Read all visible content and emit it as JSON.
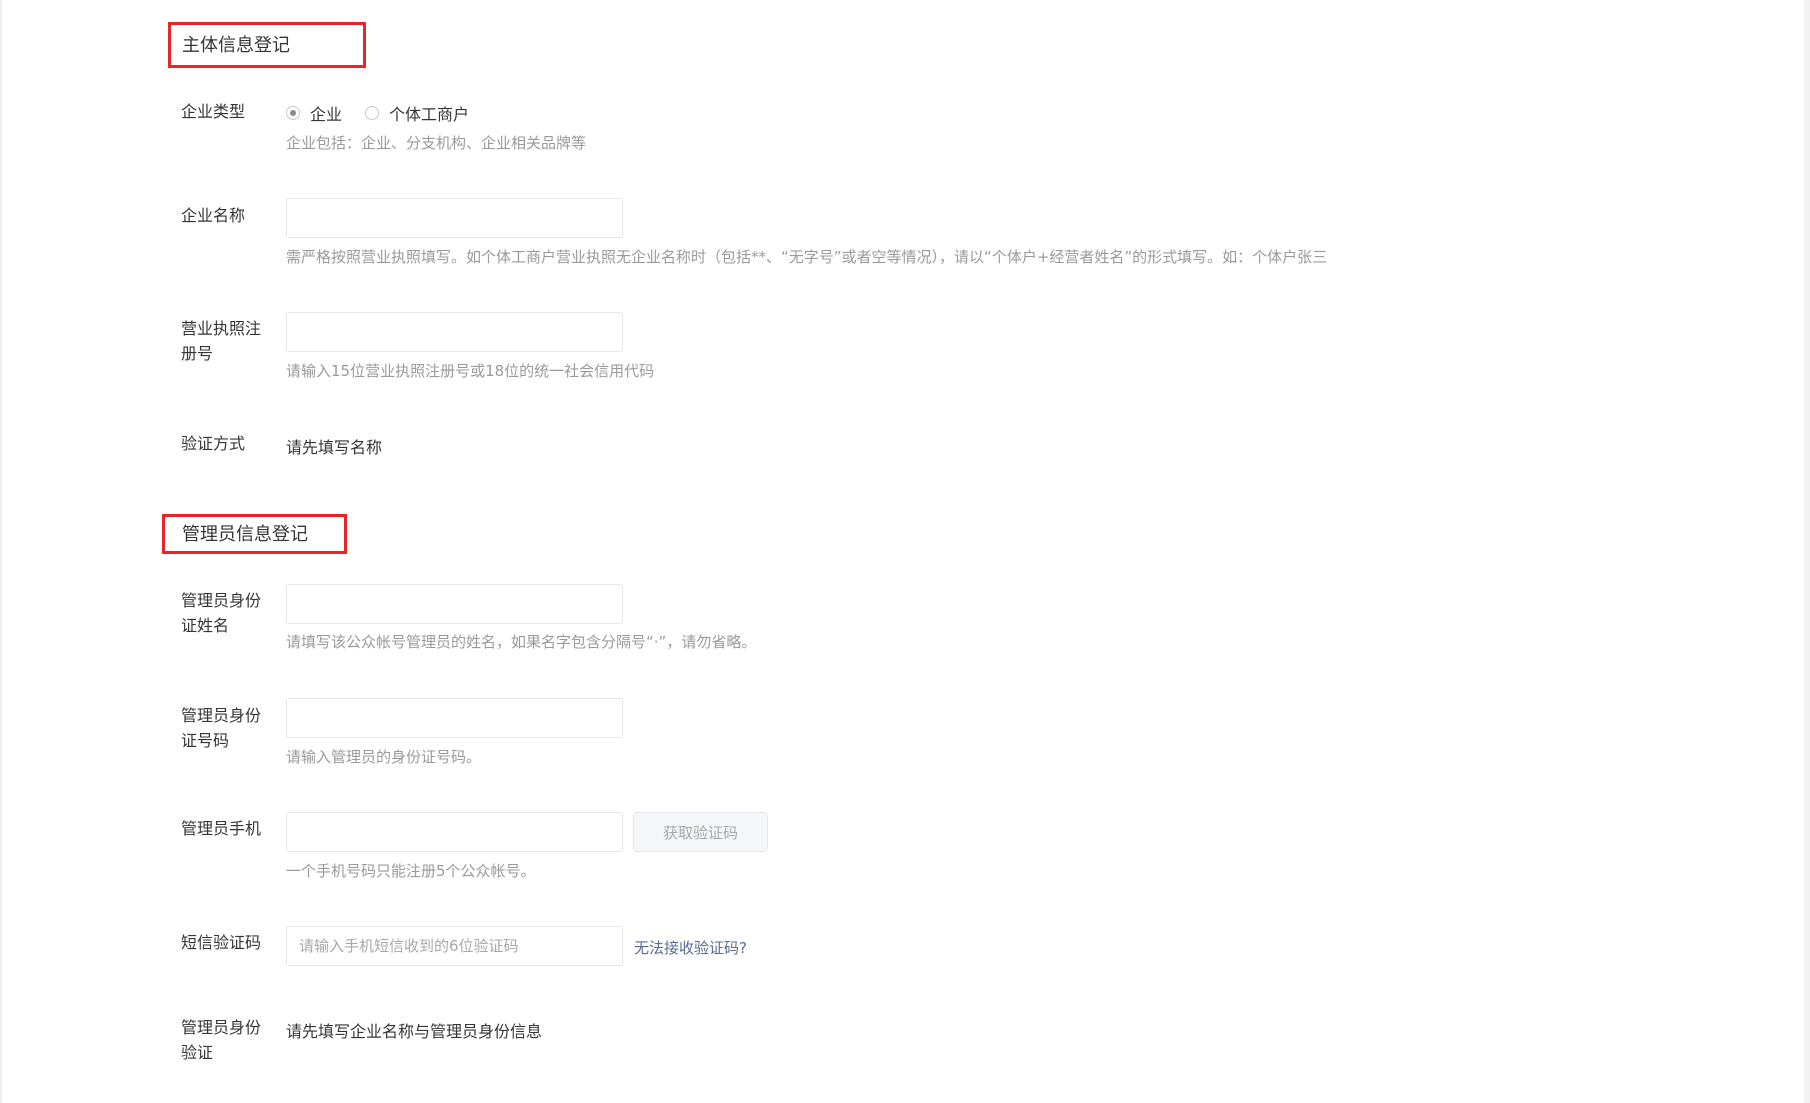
{
  "sections": {
    "subject": {
      "title": "主体信息登记"
    },
    "admin": {
      "title": "管理员信息登记"
    }
  },
  "colors": {
    "highlight": "#e8262a",
    "link": "#576b95",
    "hint": "#9a9a9a"
  },
  "fields": {
    "enterprise_type": {
      "label": "企业类型",
      "options": [
        {
          "label": "企业",
          "selected": true
        },
        {
          "label": "个体工商户",
          "selected": false
        }
      ],
      "hint": "企业包括：企业、分支机构、企业相关品牌等"
    },
    "enterprise_name": {
      "label": "企业名称",
      "value": "",
      "hint": "需严格按照营业执照填写。如个体工商户营业执照无企业名称时（包括**、“无字号”或者空等情况），请以“个体户+经营者姓名”的形式填写。如：个体户张三"
    },
    "license_number": {
      "label_line1": "营业执照注",
      "label_line2": "册号",
      "value": "",
      "hint": "请输入15位营业执照注册号或18位的统一社会信用代码"
    },
    "verify_method": {
      "label": "验证方式",
      "text": "请先填写名称"
    },
    "admin_id_name": {
      "label_line1": "管理员身份",
      "label_line2": "证姓名",
      "value": "",
      "hint": "请填写该公众帐号管理员的姓名，如果名字包含分隔号“·”，请勿省略。"
    },
    "admin_id_number": {
      "label_line1": "管理员身份",
      "label_line2": "证号码",
      "value": "",
      "hint": "请输入管理员的身份证号码。"
    },
    "admin_phone": {
      "label": "管理员手机",
      "value": "",
      "button": "获取验证码",
      "hint": "一个手机号码只能注册5个公众帐号。"
    },
    "sms_code": {
      "label": "短信验证码",
      "placeholder": "请输入手机短信收到的6位验证码",
      "value": "",
      "link": "无法接收验证码?"
    },
    "admin_verify": {
      "label_line1": "管理员身份",
      "label_line2": "验证",
      "text": "请先填写企业名称与管理员身份信息"
    }
  }
}
